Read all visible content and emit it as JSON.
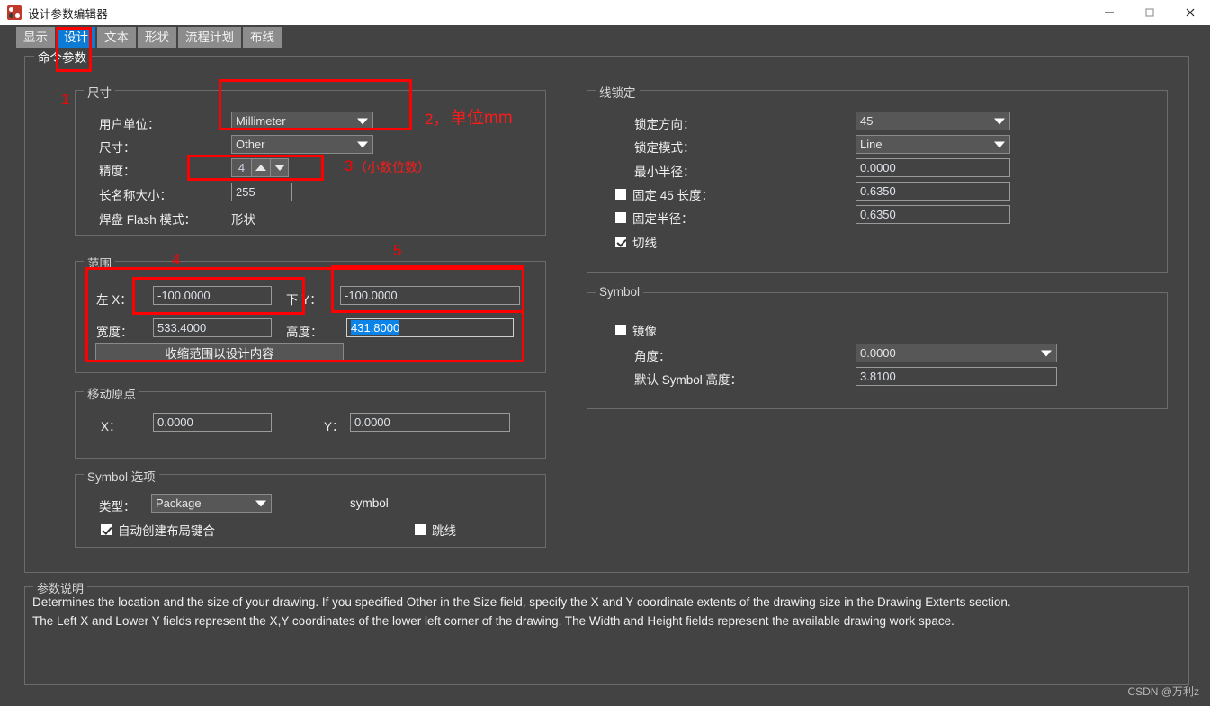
{
  "window": {
    "title": "设计参数编辑器",
    "icon": "app-icon",
    "minimize": "—",
    "maximize": "□",
    "close": "✕"
  },
  "tabs": [
    {
      "label": "显示",
      "active": false
    },
    {
      "label": "设计",
      "active": true
    },
    {
      "label": "文本",
      "active": false
    },
    {
      "label": "形状",
      "active": false
    },
    {
      "label": "流程计划",
      "active": false
    },
    {
      "label": "布线",
      "active": false
    }
  ],
  "command_params": {
    "legend": "命令参数"
  },
  "size_group": {
    "legend": "尺寸",
    "user_unit_label": "用户单位：",
    "user_unit_value": "Millimeter",
    "size_label": "尺寸：",
    "size_value": "Other",
    "accuracy_label": "精度：",
    "accuracy_value": "4",
    "long_name_label": "长名称大小：",
    "long_name_value": "255",
    "pad_flash_label": "焊盘 Flash 模式：",
    "pad_flash_value": "形状"
  },
  "extents_group": {
    "legend": "范围",
    "left_x_label": "左 X：",
    "left_x_value": "-100.0000",
    "lower_y_label": "下 Y：",
    "lower_y_value": "-100.0000",
    "width_label": "宽度：",
    "width_value": "533.4000",
    "height_label": "高度：",
    "height_value": "431.8000",
    "shrink_button": "收缩范围以设计内容"
  },
  "move_origin_group": {
    "legend": "移动原点",
    "x_label": "X：",
    "x_value": "0.0000",
    "y_label": "Y：",
    "y_value": "0.0000"
  },
  "symbol_options_group": {
    "legend": "Symbol 选项",
    "type_label": "类型：",
    "type_value": "Package",
    "symbol_text": "symbol",
    "auto_keepin_label": "自动创建布局键合",
    "auto_keepin_checked": true,
    "jumper_label": "跳线",
    "jumper_checked": false
  },
  "line_lock_group": {
    "legend": "线锁定",
    "lock_direction_label": "锁定方向：",
    "lock_direction_value": "45",
    "lock_mode_label": "锁定模式：",
    "lock_mode_value": "Line",
    "min_radius_label": "最小半径：",
    "min_radius_value": "0.0000",
    "fixed45_label": "固定 45 长度：",
    "fixed45_checked": false,
    "fixed45_value": "0.6350",
    "fixed_radius_label": "固定半径：",
    "fixed_radius_checked": false,
    "fixed_radius_value": "0.6350",
    "tangent_label": "切线",
    "tangent_checked": true
  },
  "symbol_group": {
    "legend": "Symbol",
    "mirror_label": "镜像",
    "mirror_checked": false,
    "angle_label": "角度：",
    "angle_value": "0.0000",
    "default_height_label": "默认 Symbol 高度：",
    "default_height_value": "3.8100"
  },
  "description": {
    "legend": "参数说明",
    "line1": "Determines the location and the size of your drawing. If you specified Other in the Size field, specify the X and Y coordinate extents of the drawing size in the Drawing Extents section.",
    "line2": "The Left X and Lower Y fields represent the X,Y coordinates of the lower left corner of the drawing. The Width and Height fields represent the available drawing work space."
  },
  "annotations": {
    "n1": "1",
    "n2": "2，",
    "n2_text": "单位mm",
    "n3": "3",
    "n3_text": "（小数位数）",
    "n4": "4",
    "n5": "5"
  },
  "watermark": "CSDN @万利z",
  "colors": {
    "background": "#434343",
    "accent_blue": "#0d7ad4",
    "selection_blue": "#0a84e8",
    "annotation_red": "#ff0000",
    "titlebar": "#ffffff"
  }
}
